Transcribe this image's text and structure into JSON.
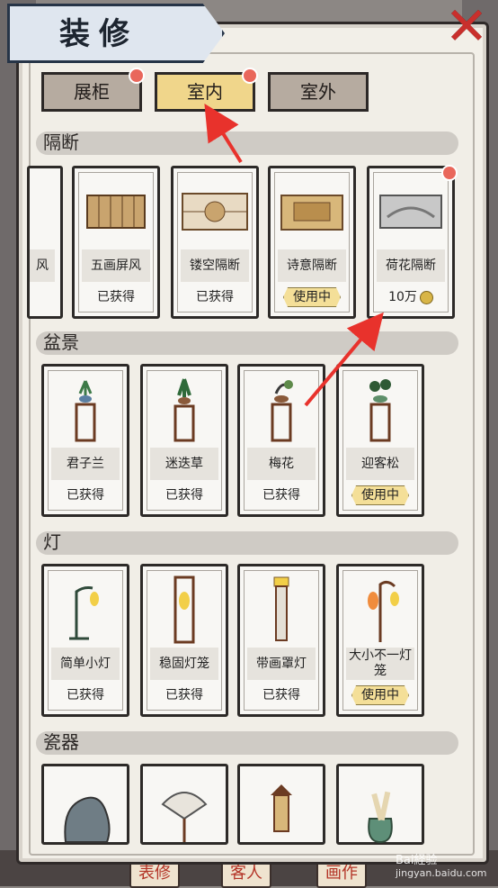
{
  "header": {
    "title": "装修",
    "close_icon": "close-icon"
  },
  "tabs": [
    {
      "label": "展柜",
      "active": false,
      "badge": true
    },
    {
      "label": "室内",
      "active": true,
      "badge": true
    },
    {
      "label": "室外",
      "active": false,
      "badge": false
    }
  ],
  "sections": {
    "partition": {
      "title": "隔断",
      "cards": [
        {
          "name": "风",
          "status": ""
        },
        {
          "name": "五画屏风",
          "status": "已获得"
        },
        {
          "name": "镂空隔断",
          "status": "已获得"
        },
        {
          "name": "诗意隔断",
          "status": "使用中"
        },
        {
          "name": "荷花隔断",
          "status": "10万"
        }
      ]
    },
    "bonsai": {
      "title": "盆景",
      "cards": [
        {
          "name": "君子兰",
          "status": "已获得"
        },
        {
          "name": "迷迭草",
          "status": "已获得"
        },
        {
          "name": "梅花",
          "status": "已获得"
        },
        {
          "name": "迎客松",
          "status": "使用中"
        }
      ]
    },
    "lamp": {
      "title": "灯",
      "cards": [
        {
          "name": "简单小灯",
          "status": "已获得"
        },
        {
          "name": "稳固灯笼",
          "status": "已获得"
        },
        {
          "name": "带画罩灯",
          "status": "已获得"
        },
        {
          "name": "大小不一灯笼",
          "status": "使用中"
        }
      ]
    },
    "porcelain": {
      "title": "瓷器"
    }
  },
  "bottom_nav": [
    "表修",
    "客人",
    "画作"
  ],
  "watermark": {
    "line1": "Bai経验",
    "line2": "jingyan.baidu.com"
  },
  "colors": {
    "active_tab": "#f0d68b",
    "badge": "#e9675b",
    "arrow": "#e8322c"
  }
}
